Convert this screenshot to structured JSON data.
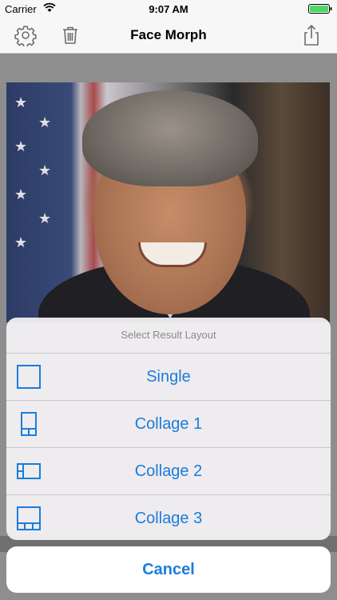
{
  "status_bar": {
    "carrier": "Carrier",
    "time": "9:07 AM"
  },
  "navbar": {
    "title": "Face Morph",
    "icons": [
      "settings-gear-icon",
      "trash-icon",
      "share-icon"
    ]
  },
  "action_sheet": {
    "title": "Select Result Layout",
    "options": [
      {
        "label": "Single",
        "icon": "single-layout-icon"
      },
      {
        "label": "Collage 1",
        "icon": "collage-1-layout-icon"
      },
      {
        "label": "Collage 2",
        "icon": "collage-2-layout-icon"
      },
      {
        "label": "Collage 3",
        "icon": "collage-3-layout-icon"
      }
    ],
    "cancel_label": "Cancel"
  },
  "colors": {
    "accent": "#1a7ddb"
  }
}
